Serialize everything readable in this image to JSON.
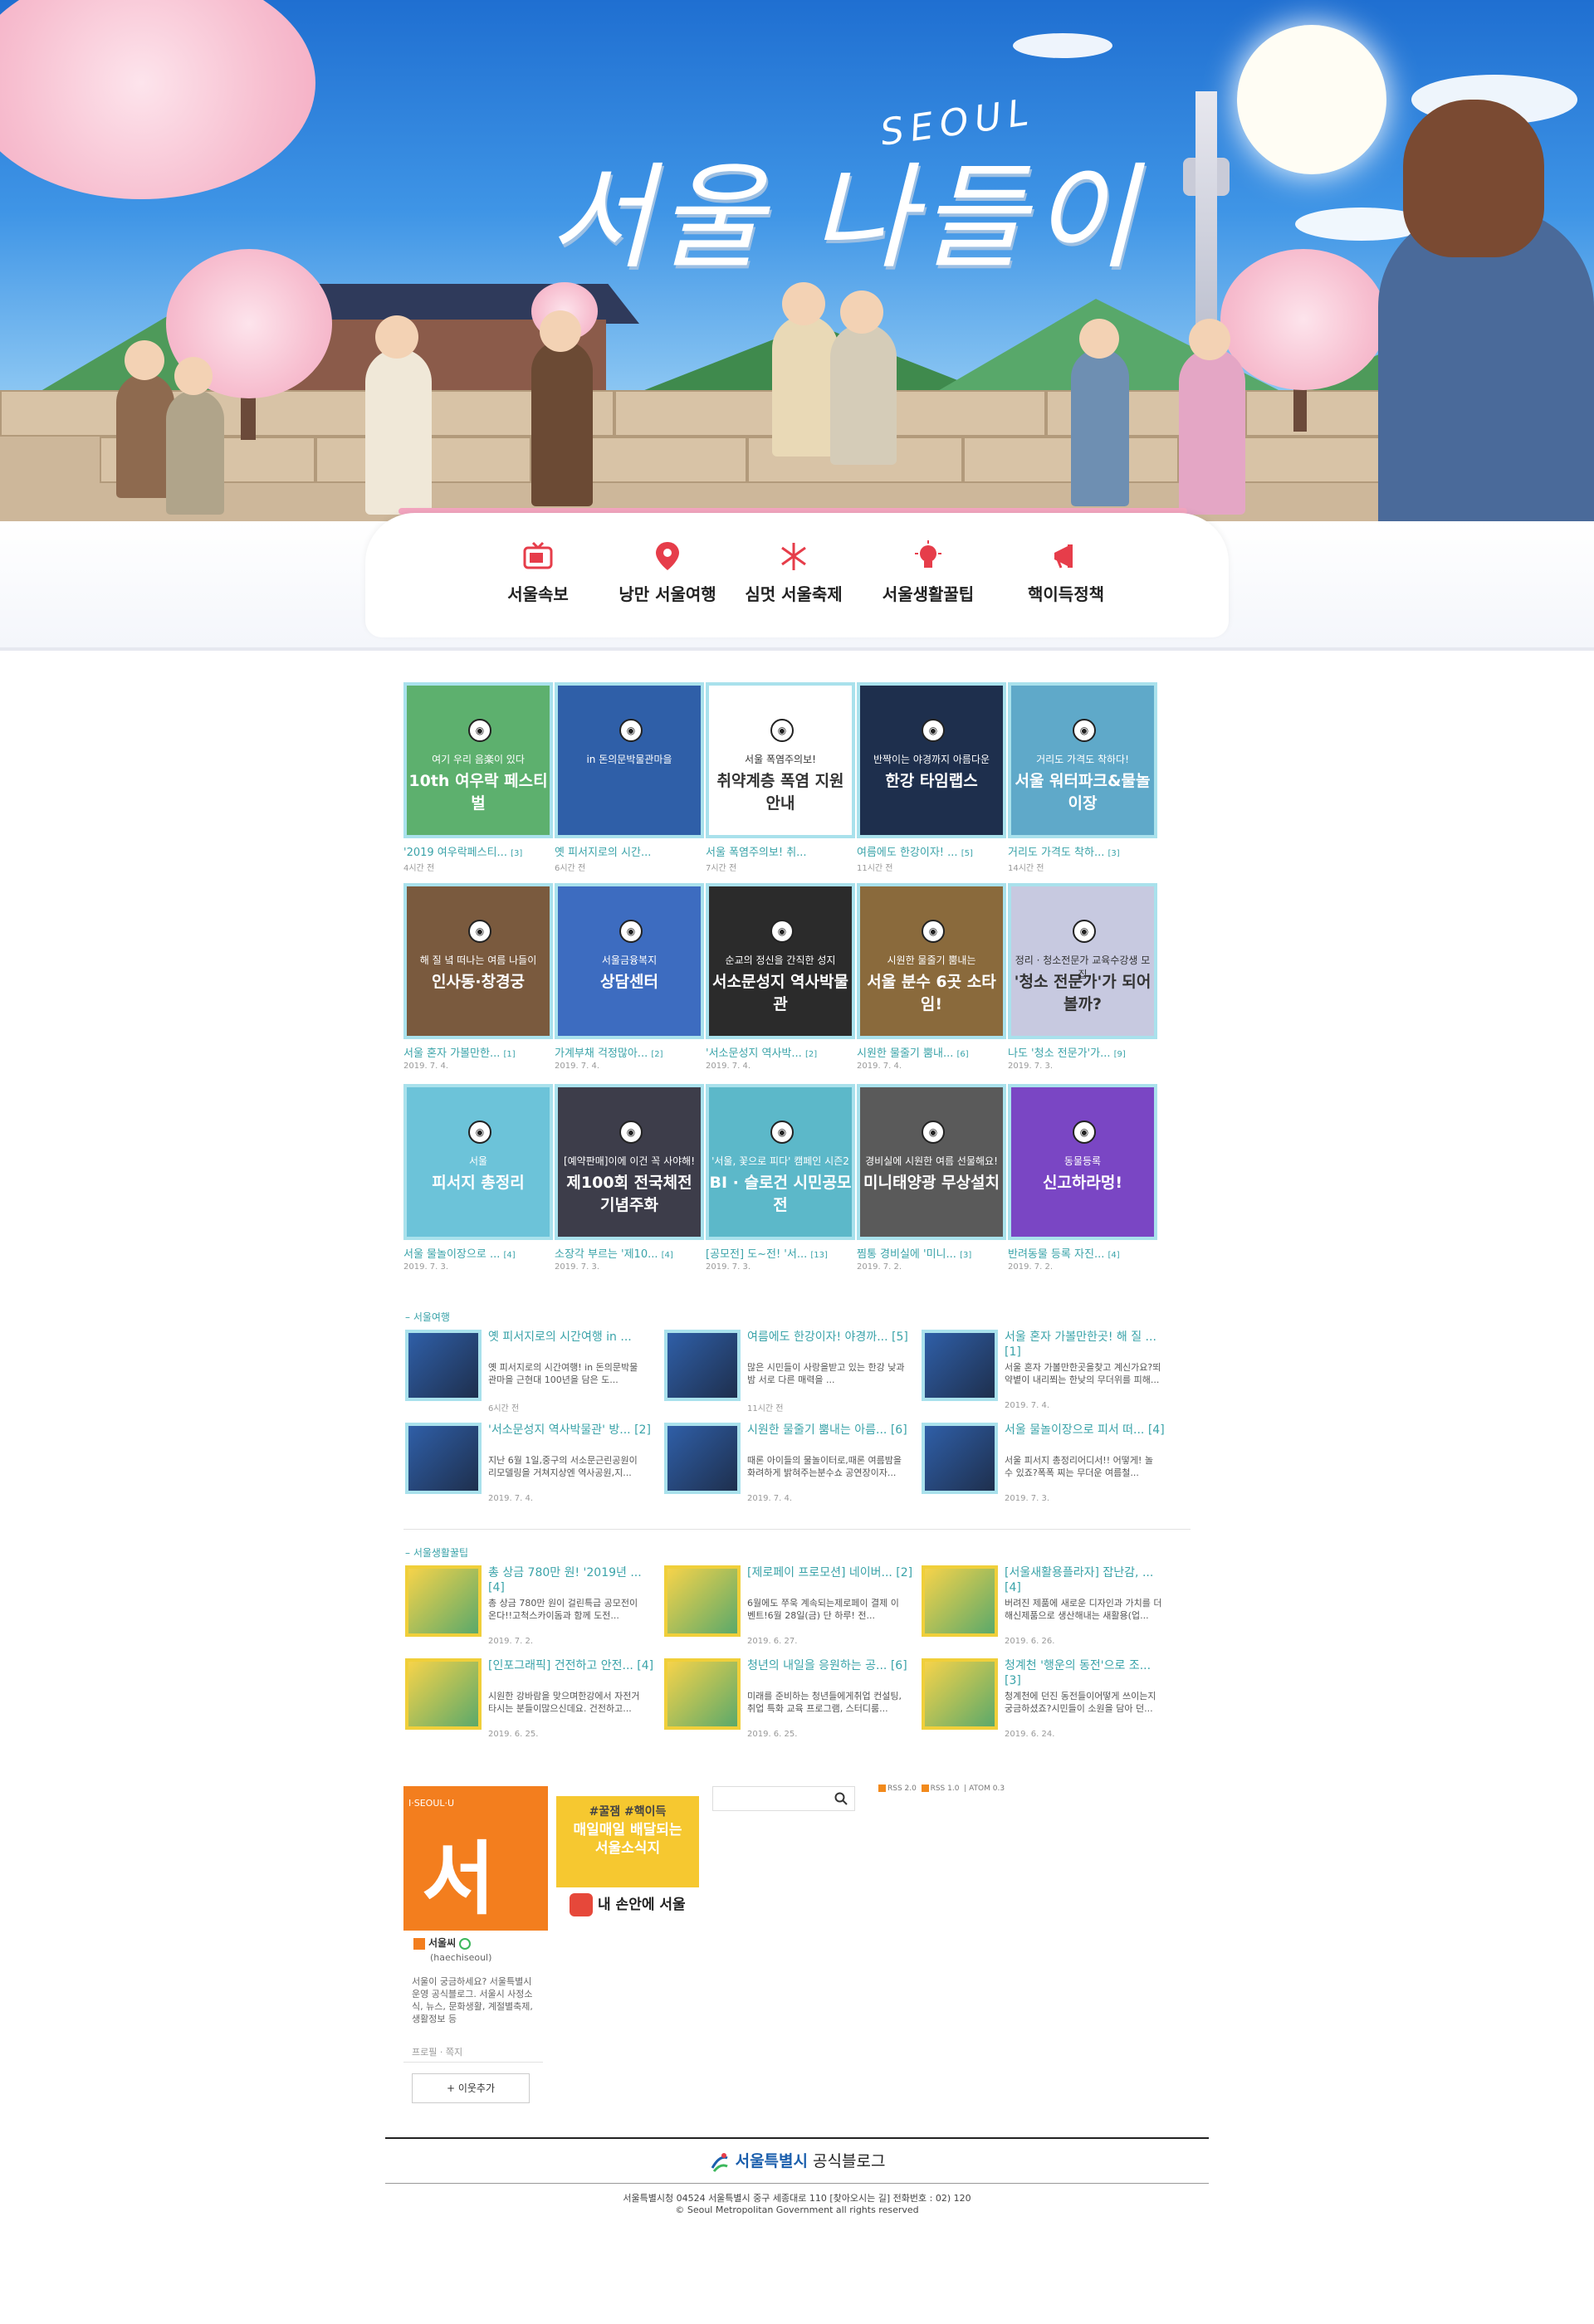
{
  "hero": {
    "title": "서울 나들이",
    "subtitle": "SEOUL"
  },
  "nav": [
    {
      "label": "서울속보",
      "icon": "tv-icon"
    },
    {
      "label": "낭만 서울여행",
      "icon": "map-pin-icon"
    },
    {
      "label": "심멋 서울축제",
      "icon": "firework-icon"
    },
    {
      "label": "서울생활꿀팁",
      "icon": "lightbulb-icon"
    },
    {
      "label": "핵이득정책",
      "icon": "megaphone-icon"
    }
  ],
  "grid": [
    {
      "title": "'2019 여우락페스티...",
      "count": "[3]",
      "date": "4시간 전",
      "thumb_line1": "여기 우리 음楽이 있다",
      "thumb_line2": "10th 여우락 페스티벌",
      "color": "#5db06e"
    },
    {
      "title": "옛 피서지로의 시간...",
      "count": "",
      "date": "6시간 전",
      "thumb_line1": "in 돈의문박물관마을",
      "thumb_line2": "",
      "color": "#2f5fa8"
    },
    {
      "title": "서울 폭염주의보! 취...",
      "count": "",
      "date": "7시간 전",
      "thumb_line1": "서울 폭염주의보!",
      "thumb_line2": "취약계층 폭염 지원 안내",
      "color": "#ffffff"
    },
    {
      "title": "여름에도 한강이자! ...",
      "count": "[5]",
      "date": "11시간 전",
      "thumb_line1": "반짝이는 야경까지 아름다운",
      "thumb_line2": "한강 타임랩스",
      "color": "#1e2f4d"
    },
    {
      "title": "거리도 가격도 착하...",
      "count": "[3]",
      "date": "14시간 전",
      "thumb_line1": "거리도 가격도 착하다!",
      "thumb_line2": "서울 워터파크&물놀이장",
      "color": "#5fa9c9"
    },
    {
      "title": "서울 혼자 가볼만한...",
      "count": "[1]",
      "date": "2019. 7. 4.",
      "thumb_line1": "해 질 녘 떠나는 여름 나들이",
      "thumb_line2": "인사동·창경궁",
      "color": "#7a5a3e"
    },
    {
      "title": "가계부채 걱정많아...",
      "count": "[2]",
      "date": "2019. 7. 4.",
      "thumb_line1": "서울금융복지",
      "thumb_line2": "상담센터",
      "color": "#3d6cc0"
    },
    {
      "title": "'서소문성지 역사박...",
      "count": "[2]",
      "date": "2019. 7. 4.",
      "thumb_line1": "순교의 정신을 간직한 성지",
      "thumb_line2": "서소문성지 역사박물관",
      "color": "#2b2b2b"
    },
    {
      "title": "시원한 물줄기 뿜내...",
      "count": "[6]",
      "date": "2019. 7. 4.",
      "thumb_line1": "시원한 물줄기 뿜내는",
      "thumb_line2": "서울 분수 6곳 소타임!",
      "color": "#8a6a3c"
    },
    {
      "title": "나도 '청소 전문가'가...",
      "count": "[9]",
      "date": "2019. 7. 3.",
      "thumb_line1": "정리 · 청소전문가 교육수강생 모집",
      "thumb_line2": "'청소 전문가'가 되어볼까?",
      "color": "#c7c9e0"
    },
    {
      "title": "서울 물놀이장으로 ...",
      "count": "[4]",
      "date": "2019. 7. 3.",
      "thumb_line1": "서울",
      "thumb_line2": "피서지 총정리",
      "color": "#6cc3d9"
    },
    {
      "title": "소장각 부르는 '제10...",
      "count": "[4]",
      "date": "2019. 7. 3.",
      "thumb_line1": "[예약판매]이에 이건 꼭 사야해!",
      "thumb_line2": "제100회 전국체전 기념주화",
      "color": "#3d3d4a"
    },
    {
      "title": "[공모전] 도~전! '서...",
      "count": "[13]",
      "date": "2019. 7. 3.",
      "thumb_line1": "'서울, 꽃으로 피다' 캠페인 시즌2",
      "thumb_line2": "BI · 슬로건 시민공모전",
      "color": "#5cb8c9"
    },
    {
      "title": "찜통 경비실에 '미니...",
      "count": "[3]",
      "date": "2019. 7. 2.",
      "thumb_line1": "경비실에 시원한 여름 선물해요!",
      "thumb_line2": "미니태양광 무상설치",
      "color": "#5a5a5a"
    },
    {
      "title": "반려동물 등록 자진...",
      "count": "[4]",
      "date": "2019. 7. 2.",
      "thumb_line1": "동물등록",
      "thumb_line2": "신고하라멍!",
      "color": "#7a46c4"
    }
  ],
  "sections": [
    {
      "title": "– 서울여행",
      "items": [
        {
          "title": "옛 피서지로의 시간여행 in ...",
          "desc": "옛 피서지로의 시간여행! in 돈의문박물관마을 근현대 100년을 담은 도...",
          "date": "6시간 전"
        },
        {
          "title": "여름에도 한강이자! 야경까... [5]",
          "desc": "많은 시민들이 사랑을받고 있는 한강 낮과 밤 서로 다른 매력을 ...",
          "date": "11시간 전"
        },
        {
          "title": "서울 혼자 가볼만한곳! 해 질 ... [1]",
          "desc": "서울 혼자 가볼만한곳을찾고 계신가요?뙤약볕이 내리쬐는 한낮의 무더위를 피해...",
          "date": "2019. 7. 4."
        },
        {
          "title": "'서소문성지 역사박물관' 방... [2]",
          "desc": "지난 6월 1일,중구의 서소문근린공원이 리모델링을 거쳐지상엔 역사공원,지...",
          "date": "2019. 7. 4."
        },
        {
          "title": "시원한 물줄기 뿜내는 아름... [6]",
          "desc": "때론 아이들의 물놀이터로,때론 여름밤을 화려하게 밝혀주는분수쇼 공연장이자...",
          "date": "2019. 7. 4."
        },
        {
          "title": "서울 물놀이장으로 피서 떠... [4]",
          "desc": "서울 피서지 총정리어디서!! 어떻게! 놀 수 있죠?폭폭 찌는 무더운 여름철...",
          "date": "2019. 7. 3."
        }
      ]
    },
    {
      "title": "– 서울생활꿀팁",
      "items": [
        {
          "title": "총 상금 780만 원! '2019년 ... [4]",
          "desc": "총 상금 780만 원이 걸린특급 공모전이 온다!!고척스카이돔과 함께 도전...",
          "date": "2019. 7. 2."
        },
        {
          "title": "[제로페이 프로모션] 네이버... [2]",
          "desc": "6월에도 쭈욱 계속되는제로페이 결제 이벤트!6월 28일(금) 단 하루! 전...",
          "date": "2019. 6. 27."
        },
        {
          "title": "[서울새활용플라자] 잡난감, ... [4]",
          "desc": "버려진 제품에 새로운 디자인과 가치를 더해신제품으로 생산해내는 새활용(업...",
          "date": "2019. 6. 26."
        },
        {
          "title": "[인포그래픽] 건전하고 안전... [4]",
          "desc": "시원한 강바람을 맞으며한강에서 자전거 타시는 분들이많으신데요. 건전하고...",
          "date": "2019. 6. 25."
        },
        {
          "title": "청년의 내일을 응원하는 공... [6]",
          "desc": "미래를 준비하는 청년들에게취업 컨설팅, 취업 특화 교육 프로그램, 스터디룸...",
          "date": "2019. 6. 25."
        },
        {
          "title": "청계천 '행운의 동전'으로 조... [3]",
          "desc": "청계천에 던진 동전들이어떻게 쓰이는지 궁금하셨죠?시민들이 소원을 담아 던...",
          "date": "2019. 6. 24."
        }
      ]
    }
  ],
  "profile": {
    "logo_text": "I·SEOUL·U",
    "image_text": "서울",
    "name": "서울씨",
    "id": "(haechiseoul)",
    "desc": "서울이 궁금하세요? 서울특별시 운영 공식블로그. 서울시 사정소식, 뉴스, 문화생활, 계절별축제, 생활정보 등",
    "links": "프로필 · 쪽지",
    "add_button": "+ 이웃추가"
  },
  "banner": {
    "tag": "#꿀잼 #핵이득",
    "line1": "매일매일 배달되는",
    "line2": "서울소식지",
    "footer": "내 손안에 서울"
  },
  "search": {
    "placeholder": ""
  },
  "rss": {
    "r1": "RSS 2.0",
    "r2": "RSS 1.0",
    "r3": "ATOM 0.3"
  },
  "footer": {
    "logo_bold": "서울특별시",
    "logo_rest": " 공식블로그",
    "address": "서울특별시청 04524 서울특별시 중구 세종대로 110 [찾아오시는 길] 전화번호 : 02) 120",
    "copyright": "© Seoul Metropolitan Government all rights reserved"
  }
}
